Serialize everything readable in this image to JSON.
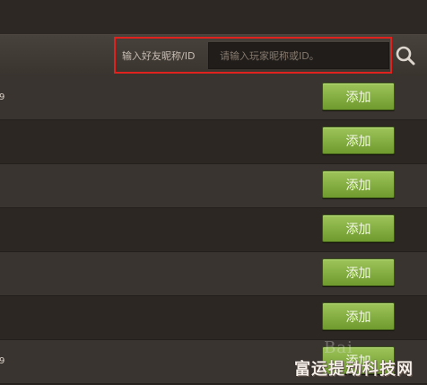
{
  "search": {
    "label": "输入好友昵称/ID",
    "placeholder": "请输入玩家昵称或ID。",
    "icon": "search-icon"
  },
  "annotation": {
    "arrow_color": "#e0221f",
    "highlight_color": "#e0221f"
  },
  "friends": {
    "rows": [
      {
        "text": "9",
        "button_label": "添加"
      },
      {
        "text": "",
        "button_label": "添加"
      },
      {
        "text": "",
        "button_label": "添加"
      },
      {
        "text": "",
        "button_label": "添加"
      },
      {
        "text": "",
        "button_label": "添加"
      },
      {
        "text": "",
        "button_label": "添加"
      },
      {
        "text": "9",
        "button_label": "添加"
      }
    ]
  },
  "watermark": {
    "text": "富运提动科技网",
    "baidu": "Bai"
  },
  "colors": {
    "button_green": "#7fae3c",
    "background": "#2a2521"
  }
}
